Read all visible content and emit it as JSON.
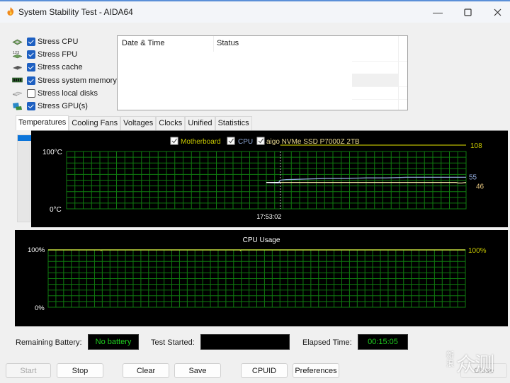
{
  "window": {
    "title": "System Stability Test - AIDA64",
    "controls": {
      "minimize": "—",
      "maximize": "☐",
      "close": "✕"
    }
  },
  "stress_options": [
    {
      "label": "Stress CPU",
      "checked": true,
      "icon": "cpu-chip-icon"
    },
    {
      "label": "Stress FPU",
      "checked": true,
      "icon": "fpu-123-icon"
    },
    {
      "label": "Stress cache",
      "checked": true,
      "icon": "cache-icon"
    },
    {
      "label": "Stress system memory",
      "checked": true,
      "icon": "memory-module-icon"
    },
    {
      "label": "Stress local disks",
      "checked": false,
      "icon": "disk-drive-icon"
    },
    {
      "label": "Stress GPU(s)",
      "checked": true,
      "icon": "gpu-card-icon"
    }
  ],
  "log_table": {
    "columns": [
      "Date & Time",
      "Status"
    ],
    "rows": []
  },
  "tabs": [
    {
      "label": "Temperatures",
      "active": true
    },
    {
      "label": "Cooling Fans",
      "active": false
    },
    {
      "label": "Voltages",
      "active": false
    },
    {
      "label": "Clocks",
      "active": false
    },
    {
      "label": "Unified",
      "active": false
    },
    {
      "label": "Statistics",
      "active": false
    }
  ],
  "chart_data": [
    {
      "type": "line",
      "title": "Temperatures",
      "legend": [
        {
          "name": "Motherboard",
          "checked": true,
          "color": "#c8c800"
        },
        {
          "name": "CPU",
          "checked": true,
          "color": "#8fa8d8"
        },
        {
          "name": "aigo NVMe SSD P7000Z 2TB",
          "checked": true,
          "color": "#e8d890"
        }
      ],
      "legend_placement": "top-center",
      "ylabel_top": "100°C",
      "ylabel_bottom": "0°C",
      "ylim": [
        0,
        100
      ],
      "x_marker_label": "17:53:02",
      "x_marker_position": 0.535,
      "grid": true,
      "series": [
        {
          "name": "Motherboard",
          "color": "#9a9a00",
          "current_label": "108",
          "x": [
            0.535,
            1.0
          ],
          "values": [
            108,
            108
          ]
        },
        {
          "name": "CPU",
          "color": "#8fa8d8",
          "current_label": "55",
          "x": [
            0.5,
            0.53,
            0.535,
            0.55,
            0.6,
            0.65,
            0.7,
            0.75,
            0.8,
            0.85,
            0.9,
            0.95,
            1.0
          ],
          "values": [
            46,
            45,
            50,
            51,
            52,
            53,
            53,
            54,
            54,
            55,
            55,
            55,
            55
          ]
        },
        {
          "name": "aigo NVMe SSD P7000Z 2TB",
          "color": "#f0e0a0",
          "current_label": "46",
          "x": [
            0.5,
            0.53,
            0.535,
            0.6,
            0.7,
            0.8,
            0.9,
            0.975,
            0.98,
            0.99,
            1.0
          ],
          "values": [
            46,
            46,
            46,
            46,
            46,
            46,
            46,
            46,
            45,
            45,
            46
          ]
        }
      ]
    },
    {
      "type": "line",
      "title": "CPU Usage",
      "ylabel_top": "100%",
      "ylabel_bottom": "0%",
      "ylim": [
        0,
        100
      ],
      "grid": true,
      "series": [
        {
          "name": "CPU Usage",
          "color": "#c8e040",
          "current_label": "100%",
          "x": [
            0,
            0.126,
            0.127,
            0.128,
            0.46,
            0.461,
            0.462,
            1.0
          ],
          "values": [
            100,
            100,
            99,
            100,
            100,
            99,
            100,
            100
          ]
        }
      ]
    }
  ],
  "status": {
    "remaining_battery_label": "Remaining Battery:",
    "remaining_battery_value": "No battery",
    "test_started_label": "Test Started:",
    "test_started_value": "",
    "elapsed_time_label": "Elapsed Time:",
    "elapsed_time_value": "00:15:05"
  },
  "buttons": {
    "start": "Start",
    "stop": "Stop",
    "clear": "Clear",
    "save": "Save",
    "cpuid": "CPUID",
    "preferences": "Preferences",
    "close": "Close"
  },
  "watermark": {
    "small": "新浪",
    "big": "众测"
  }
}
